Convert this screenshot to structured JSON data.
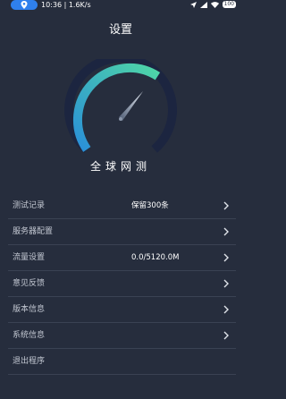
{
  "status_bar": {
    "text": "10:36 | 1.6K/s",
    "battery": "100",
    "icons": [
      "location-icon",
      "ring-off-icon",
      "alarm-icon",
      "navigation-icon",
      "wifi-icon",
      "battery-icon"
    ]
  },
  "header": {
    "title": "设置"
  },
  "gauge": {
    "label": "全球网测",
    "arc_color_start": "#4fd6a6",
    "arc_color_end": "#2a8fd8",
    "track_color": "#1c2540"
  },
  "menu": {
    "items": [
      {
        "label": "测试记录",
        "value": "保留300条"
      },
      {
        "label": "服务器配置",
        "value": ""
      },
      {
        "label": "流量设置",
        "value": "0.0/5120.0M"
      },
      {
        "label": "意见反馈",
        "value": ""
      },
      {
        "label": "版本信息",
        "value": ""
      },
      {
        "label": "系统信息",
        "value": ""
      },
      {
        "label": "退出程序",
        "value": ""
      }
    ]
  },
  "colors": {
    "background": "#262d3d",
    "accent": "#2f80ed",
    "divider": "#3a4253"
  }
}
